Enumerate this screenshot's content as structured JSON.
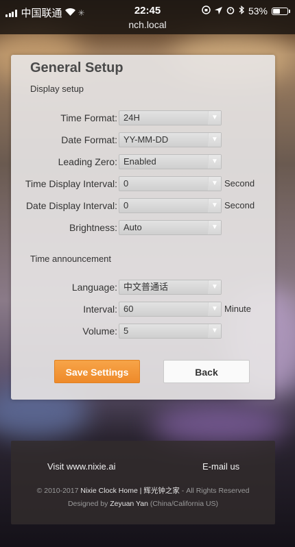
{
  "status_bar": {
    "carrier": "中国联通",
    "time": "22:45",
    "url": "nch.local",
    "battery": "53%",
    "battery_level": 0.53
  },
  "panel": {
    "title": "General Setup",
    "display_section": "Display setup",
    "announce_section": "Time announcement",
    "fields": [
      {
        "label": "Time Format:",
        "value": "24H",
        "unit": ""
      },
      {
        "label": "Date Format:",
        "value": "YY-MM-DD",
        "unit": ""
      },
      {
        "label": "Leading Zero:",
        "value": "Enabled",
        "unit": ""
      },
      {
        "label": "Time Display Interval:",
        "value": "0",
        "unit": "Second"
      },
      {
        "label": "Date Display Interval:",
        "value": "0",
        "unit": "Second"
      },
      {
        "label": "Brightness:",
        "value": "Auto",
        "unit": ""
      },
      {
        "label": "Language:",
        "value": "中文普通话",
        "unit": ""
      },
      {
        "label": "Interval:",
        "value": "60",
        "unit": "Minute"
      },
      {
        "label": "Volume:",
        "value": "5",
        "unit": ""
      }
    ],
    "save_label": "Save Settings",
    "back_label": "Back"
  },
  "footer": {
    "visit_label": "Visit www.nixie.ai",
    "email_label": "E-mail us",
    "copyright_prefix": "© 2010-2017",
    "site_name": "Nixie Clock Home | 辉光钟之家",
    "rights": "- All Rights Reserved",
    "designed_by": "Designed by",
    "designer": "Zeyuan Yan",
    "location": "(China/California US)"
  }
}
